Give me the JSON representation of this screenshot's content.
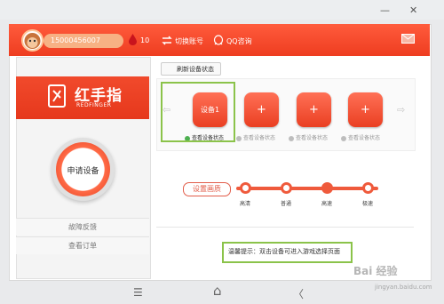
{
  "window": {
    "minimize": "—",
    "close": "✕"
  },
  "header": {
    "username": "15000456007",
    "balance": "10",
    "switch_account": "切换账号",
    "qq_support": "QQ咨询",
    "colors": {
      "header": "#ef4a2c",
      "accent": "#e84a2f"
    }
  },
  "sidebar": {
    "logo_text": "红手指",
    "logo_sub": "REDFINGER",
    "apply_device": "申请设备",
    "feedback": "故障反馈",
    "view_orders": "查看订单"
  },
  "main": {
    "refresh_label": "刷新设备状态",
    "devices": [
      {
        "label": "设备1",
        "status": "查看设备状态",
        "active": true
      },
      {
        "label": "+",
        "status": "查看设备状态",
        "active": false
      },
      {
        "label": "+",
        "status": "查看设备状态",
        "active": false
      },
      {
        "label": "+",
        "status": "查看设备状态",
        "active": false
      }
    ],
    "quality_button": "设置画质",
    "quality_options": [
      "高清",
      "普通",
      "高速",
      "极速"
    ],
    "quality_selected": "高速",
    "tip": "温馨提示：双击设备可进入游戏选择页面"
  },
  "nav": {
    "menu": "☰",
    "home": "⌂",
    "back": "〈"
  },
  "watermark": {
    "main": "Bai 经验",
    "sub": "jingyan.baidu.com"
  }
}
